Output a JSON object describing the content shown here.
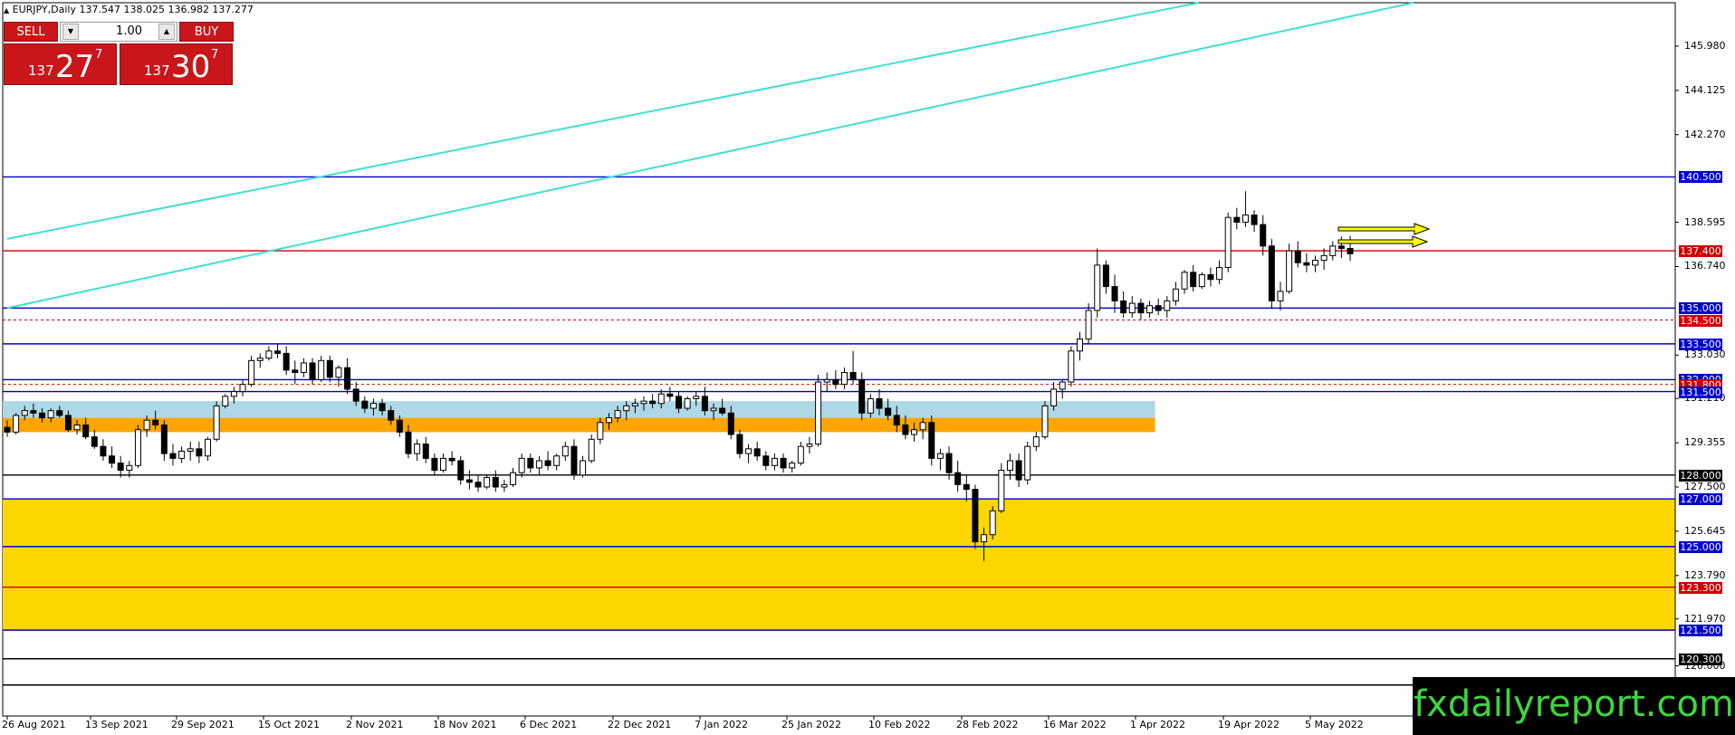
{
  "header": {
    "symbol_text": "EURJPY,Daily  137.547 138.025 136.982 137.277"
  },
  "trade_panel": {
    "sell_label": "SELL",
    "buy_label": "BUY",
    "lot_value": "1.00",
    "sell_price_small": "137",
    "sell_price_big": "27",
    "sell_price_sup": "7",
    "buy_price_small": "137",
    "buy_price_big": "30",
    "buy_price_sup": "7"
  },
  "brand": {
    "text": "fxdailyreport.com"
  },
  "colors": {
    "bull_body": "#ffffff",
    "bear_body": "#000000",
    "wick": "#000000",
    "blue_level": "#0000cc",
    "red_level": "#cc0000",
    "trendline": "#40e0d0",
    "zone_gold": "#ffd700",
    "zone_orange": "#ffa500",
    "zone_lightblue": "#add8e6",
    "arrow_fill": "#ffff00"
  },
  "chart_data": {
    "type": "candlestick",
    "symbol": "EURJPY",
    "timeframe": "Daily",
    "ylim": [
      117.9,
      147.8
    ],
    "y_ticks": [
      "145.980",
      "144.125",
      "142.270",
      "138.595",
      "136.740",
      "133.030",
      "131.210",
      "129.355",
      "127.500",
      "125.645",
      "123.790",
      "121.970",
      "120.000"
    ],
    "x_ticks": [
      "26 Aug 2021",
      "13 Sep 2021",
      "29 Sep 2021",
      "15 Oct 2021",
      "2 Nov 2021",
      "18 Nov 2021",
      "6 Dec 2021",
      "22 Dec 2021",
      "7 Jan 2022",
      "25 Jan 2022",
      "10 Feb 2022",
      "28 Feb 2022",
      "16 Mar 2022",
      "1 Apr 2022",
      "19 Apr 2022",
      "5 May 2022"
    ],
    "horizontal_levels": [
      {
        "price": 140.5,
        "label": "140.500",
        "color": "blue",
        "style": "solid"
      },
      {
        "price": 137.4,
        "label": "137.400",
        "color": "red",
        "style": "solid"
      },
      {
        "price": 135.0,
        "label": "135.000",
        "color": "blue",
        "style": "solid"
      },
      {
        "price": 134.5,
        "label": "134.500",
        "color": "red",
        "style": "dashed"
      },
      {
        "price": 133.5,
        "label": "133.500",
        "color": "blue",
        "style": "solid"
      },
      {
        "price": 132.0,
        "label": "132.000",
        "color": "blue",
        "style": "solid"
      },
      {
        "price": 131.8,
        "label": "131.800",
        "color": "red",
        "style": "dashed"
      },
      {
        "price": 131.5,
        "label": "131.500",
        "color": "blue",
        "style": "solid"
      },
      {
        "price": 128.0,
        "label": "128.000",
        "color": "black",
        "style": "solid"
      },
      {
        "price": 127.0,
        "label": "127.000",
        "color": "blue",
        "style": "solid"
      },
      {
        "price": 125.0,
        "label": "125.000",
        "color": "blue",
        "style": "solid"
      },
      {
        "price": 123.3,
        "label": "123.300",
        "color": "red",
        "style": "solid"
      },
      {
        "price": 121.5,
        "label": "121.500",
        "color": "blue",
        "style": "solid"
      },
      {
        "price": 120.3,
        "label": "120.300",
        "color": "black",
        "style": "solid"
      },
      {
        "price": 119.2,
        "label": "119.200",
        "color": "black",
        "style": "solid"
      }
    ],
    "zones": [
      {
        "from": 121.5,
        "to": 127.0,
        "color": "gold",
        "x_end_date": "end"
      },
      {
        "from": 129.8,
        "to": 130.4,
        "color": "orange",
        "x_end_date": "5 Apr 2022"
      },
      {
        "from": 130.4,
        "to": 131.1,
        "color": "lightblue",
        "x_end_date": "5 Apr 2022"
      }
    ],
    "trendlines": [
      {
        "from": {
          "date": "26 Aug 2021",
          "price": 137.9
        },
        "to": {
          "date": "14 Apr 2022",
          "price": 147.8
        }
      },
      {
        "from": {
          "date": "26 Aug 2021",
          "price": 135.0
        },
        "to": {
          "date": "24 May 2022",
          "price": 147.8
        }
      }
    ],
    "candles": [
      [
        130.0,
        130.3,
        129.6,
        129.8
      ],
      [
        129.8,
        130.6,
        129.7,
        130.5
      ],
      [
        130.5,
        130.9,
        130.3,
        130.7
      ],
      [
        130.7,
        131.0,
        130.4,
        130.6
      ],
      [
        130.6,
        130.8,
        130.2,
        130.4
      ],
      [
        130.4,
        130.8,
        130.2,
        130.7
      ],
      [
        130.7,
        130.9,
        130.4,
        130.5
      ],
      [
        130.5,
        130.7,
        129.8,
        129.9
      ],
      [
        129.9,
        130.3,
        129.7,
        130.1
      ],
      [
        130.1,
        130.4,
        129.5,
        129.6
      ],
      [
        129.6,
        129.9,
        129.1,
        129.2
      ],
      [
        129.2,
        129.5,
        128.6,
        128.8
      ],
      [
        128.8,
        129.2,
        128.3,
        128.5
      ],
      [
        128.5,
        128.8,
        127.9,
        128.2
      ],
      [
        128.2,
        128.6,
        127.9,
        128.4
      ],
      [
        128.4,
        130.1,
        128.3,
        129.9
      ],
      [
        129.9,
        130.5,
        129.6,
        130.3
      ],
      [
        130.3,
        130.7,
        129.9,
        130.1
      ],
      [
        130.1,
        130.3,
        128.6,
        128.9
      ],
      [
        128.9,
        129.3,
        128.4,
        128.7
      ],
      [
        128.7,
        129.2,
        128.5,
        129.0
      ],
      [
        129.0,
        129.4,
        128.6,
        129.1
      ],
      [
        129.1,
        129.4,
        128.5,
        128.8
      ],
      [
        128.8,
        129.6,
        128.6,
        129.5
      ],
      [
        129.5,
        131.1,
        129.4,
        130.9
      ],
      [
        130.9,
        131.4,
        130.8,
        131.3
      ],
      [
        131.3,
        131.7,
        131.0,
        131.5
      ],
      [
        131.5,
        132.0,
        131.3,
        131.8
      ],
      [
        131.8,
        133.0,
        131.7,
        132.8
      ],
      [
        132.8,
        133.1,
        132.5,
        132.9
      ],
      [
        132.9,
        133.4,
        132.8,
        133.2
      ],
      [
        133.2,
        133.5,
        132.9,
        133.1
      ],
      [
        133.1,
        133.4,
        132.2,
        132.4
      ],
      [
        132.4,
        132.8,
        131.8,
        132.3
      ],
      [
        132.3,
        132.9,
        132.1,
        132.7
      ],
      [
        132.7,
        132.9,
        131.8,
        132.0
      ],
      [
        132.0,
        133.0,
        131.9,
        132.8
      ],
      [
        132.8,
        133.0,
        131.9,
        132.1
      ],
      [
        132.1,
        132.6,
        131.7,
        132.5
      ],
      [
        132.5,
        132.9,
        131.4,
        131.6
      ],
      [
        131.6,
        131.9,
        130.9,
        131.1
      ],
      [
        131.1,
        131.3,
        130.6,
        130.8
      ],
      [
        130.8,
        131.2,
        130.5,
        131.0
      ],
      [
        131.0,
        131.2,
        130.5,
        130.7
      ],
      [
        130.7,
        130.9,
        130.1,
        130.3
      ],
      [
        130.3,
        130.5,
        129.6,
        129.8
      ],
      [
        129.8,
        130.1,
        128.7,
        128.9
      ],
      [
        128.9,
        129.5,
        128.6,
        129.3
      ],
      [
        129.3,
        129.6,
        128.5,
        128.7
      ],
      [
        128.7,
        128.9,
        128.0,
        128.2
      ],
      [
        128.2,
        128.9,
        128.1,
        128.7
      ],
      [
        128.7,
        129.0,
        128.4,
        128.6
      ],
      [
        128.6,
        128.8,
        127.6,
        127.8
      ],
      [
        127.8,
        128.2,
        127.4,
        127.7
      ],
      [
        127.7,
        128.0,
        127.3,
        127.5
      ],
      [
        127.5,
        128.0,
        127.4,
        127.9
      ],
      [
        127.9,
        128.2,
        127.3,
        127.5
      ],
      [
        127.5,
        127.8,
        127.3,
        127.6
      ],
      [
        127.6,
        128.3,
        127.5,
        128.1
      ],
      [
        128.1,
        128.9,
        127.9,
        128.7
      ],
      [
        128.7,
        128.9,
        128.1,
        128.3
      ],
      [
        128.3,
        128.8,
        128.0,
        128.6
      ],
      [
        128.6,
        129.0,
        128.2,
        128.4
      ],
      [
        128.4,
        128.9,
        128.2,
        128.8
      ],
      [
        128.8,
        129.4,
        128.6,
        129.2
      ],
      [
        129.2,
        129.5,
        127.8,
        128.0
      ],
      [
        128.0,
        128.8,
        127.9,
        128.6
      ],
      [
        128.6,
        129.7,
        128.5,
        129.5
      ],
      [
        129.5,
        130.4,
        129.3,
        130.2
      ],
      [
        130.2,
        130.6,
        129.9,
        130.4
      ],
      [
        130.4,
        130.9,
        130.2,
        130.7
      ],
      [
        130.7,
        131.1,
        130.3,
        130.9
      ],
      [
        130.9,
        131.2,
        130.6,
        131.0
      ],
      [
        131.0,
        131.3,
        130.7,
        131.1
      ],
      [
        131.1,
        131.4,
        130.8,
        131.0
      ],
      [
        131.0,
        131.6,
        130.8,
        131.4
      ],
      [
        131.4,
        131.7,
        131.1,
        131.3
      ],
      [
        131.3,
        131.5,
        130.6,
        130.8
      ],
      [
        130.8,
        131.3,
        130.7,
        131.2
      ],
      [
        131.2,
        131.5,
        130.9,
        131.3
      ],
      [
        131.3,
        131.7,
        130.5,
        130.7
      ],
      [
        130.7,
        131.0,
        130.3,
        130.8
      ],
      [
        130.8,
        131.2,
        130.5,
        130.6
      ],
      [
        130.6,
        130.9,
        129.5,
        129.7
      ],
      [
        129.7,
        129.9,
        128.7,
        128.9
      ],
      [
        128.9,
        129.3,
        128.5,
        129.1
      ],
      [
        129.1,
        129.4,
        128.6,
        128.8
      ],
      [
        128.8,
        129.0,
        128.2,
        128.4
      ],
      [
        128.4,
        128.9,
        128.2,
        128.7
      ],
      [
        128.7,
        128.9,
        128.1,
        128.3
      ],
      [
        128.3,
        128.6,
        128.1,
        128.5
      ],
      [
        128.5,
        129.4,
        128.4,
        129.2
      ],
      [
        129.2,
        129.6,
        128.9,
        129.3
      ],
      [
        129.3,
        132.2,
        129.2,
        131.9
      ],
      [
        131.9,
        132.3,
        131.5,
        132.0
      ],
      [
        132.0,
        132.4,
        131.6,
        131.8
      ],
      [
        131.8,
        132.5,
        131.6,
        132.3
      ],
      [
        132.3,
        133.2,
        131.8,
        132.0
      ],
      [
        132.0,
        132.3,
        130.3,
        130.6
      ],
      [
        130.6,
        131.4,
        130.4,
        131.2
      ],
      [
        131.2,
        131.6,
        130.5,
        130.8
      ],
      [
        130.8,
        131.2,
        130.3,
        130.5
      ],
      [
        130.5,
        130.9,
        129.8,
        130.1
      ],
      [
        130.1,
        130.5,
        129.5,
        129.7
      ],
      [
        129.7,
        130.2,
        129.4,
        129.9
      ],
      [
        129.9,
        130.4,
        129.5,
        130.2
      ],
      [
        130.2,
        130.5,
        128.4,
        128.7
      ],
      [
        128.7,
        129.1,
        128.2,
        128.9
      ],
      [
        128.9,
        129.2,
        127.8,
        128.1
      ],
      [
        128.1,
        128.6,
        127.3,
        127.6
      ],
      [
        127.6,
        128.0,
        126.9,
        127.4
      ],
      [
        127.4,
        127.6,
        124.9,
        125.2
      ],
      [
        125.2,
        125.8,
        124.4,
        125.5
      ],
      [
        125.5,
        126.7,
        125.3,
        126.5
      ],
      [
        126.5,
        128.5,
        126.4,
        128.2
      ],
      [
        128.2,
        128.9,
        127.8,
        128.6
      ],
      [
        128.6,
        128.9,
        127.5,
        127.8
      ],
      [
        127.8,
        129.4,
        127.6,
        129.2
      ],
      [
        129.2,
        129.8,
        129.0,
        129.6
      ],
      [
        129.6,
        131.1,
        129.5,
        130.9
      ],
      [
        130.9,
        131.9,
        130.7,
        131.6
      ],
      [
        131.6,
        132.0,
        131.2,
        131.9
      ],
      [
        131.9,
        133.4,
        131.7,
        133.2
      ],
      [
        133.2,
        134.0,
        132.8,
        133.7
      ],
      [
        133.7,
        135.2,
        133.5,
        134.9
      ],
      [
        134.9,
        137.5,
        134.6,
        136.8
      ],
      [
        136.8,
        137.0,
        135.6,
        135.9
      ],
      [
        135.9,
        136.4,
        134.8,
        135.3
      ],
      [
        135.3,
        135.7,
        134.6,
        134.8
      ],
      [
        134.8,
        135.5,
        134.6,
        135.2
      ],
      [
        135.2,
        135.4,
        134.5,
        134.8
      ],
      [
        134.8,
        135.3,
        134.6,
        135.1
      ],
      [
        135.1,
        135.4,
        134.7,
        134.9
      ],
      [
        134.9,
        135.5,
        134.6,
        135.3
      ],
      [
        135.3,
        136.1,
        135.1,
        135.8
      ],
      [
        135.8,
        136.6,
        135.6,
        136.5
      ],
      [
        136.5,
        136.8,
        135.7,
        135.9
      ],
      [
        135.9,
        136.5,
        135.8,
        136.4
      ],
      [
        136.4,
        136.7,
        135.9,
        136.2
      ],
      [
        136.2,
        137.0,
        136.0,
        136.7
      ],
      [
        136.7,
        139.0,
        136.5,
        138.8
      ],
      [
        138.8,
        139.2,
        138.3,
        138.6
      ],
      [
        138.6,
        139.9,
        138.4,
        138.9
      ],
      [
        138.9,
        139.1,
        138.2,
        138.5
      ],
      [
        138.5,
        138.9,
        137.2,
        137.6
      ],
      [
        137.6,
        137.9,
        135.0,
        135.3
      ],
      [
        135.3,
        136.1,
        134.9,
        135.7
      ],
      [
        135.7,
        137.7,
        135.6,
        137.4
      ],
      [
        137.4,
        137.8,
        136.7,
        136.9
      ],
      [
        136.9,
        137.3,
        136.5,
        136.8
      ],
      [
        136.8,
        137.2,
        136.5,
        137.0
      ],
      [
        137.0,
        137.5,
        136.6,
        137.2
      ],
      [
        137.2,
        137.8,
        137.0,
        137.6
      ],
      [
        137.6,
        138.0,
        137.1,
        137.5
      ],
      [
        137.5,
        138.025,
        136.982,
        137.277
      ]
    ]
  }
}
